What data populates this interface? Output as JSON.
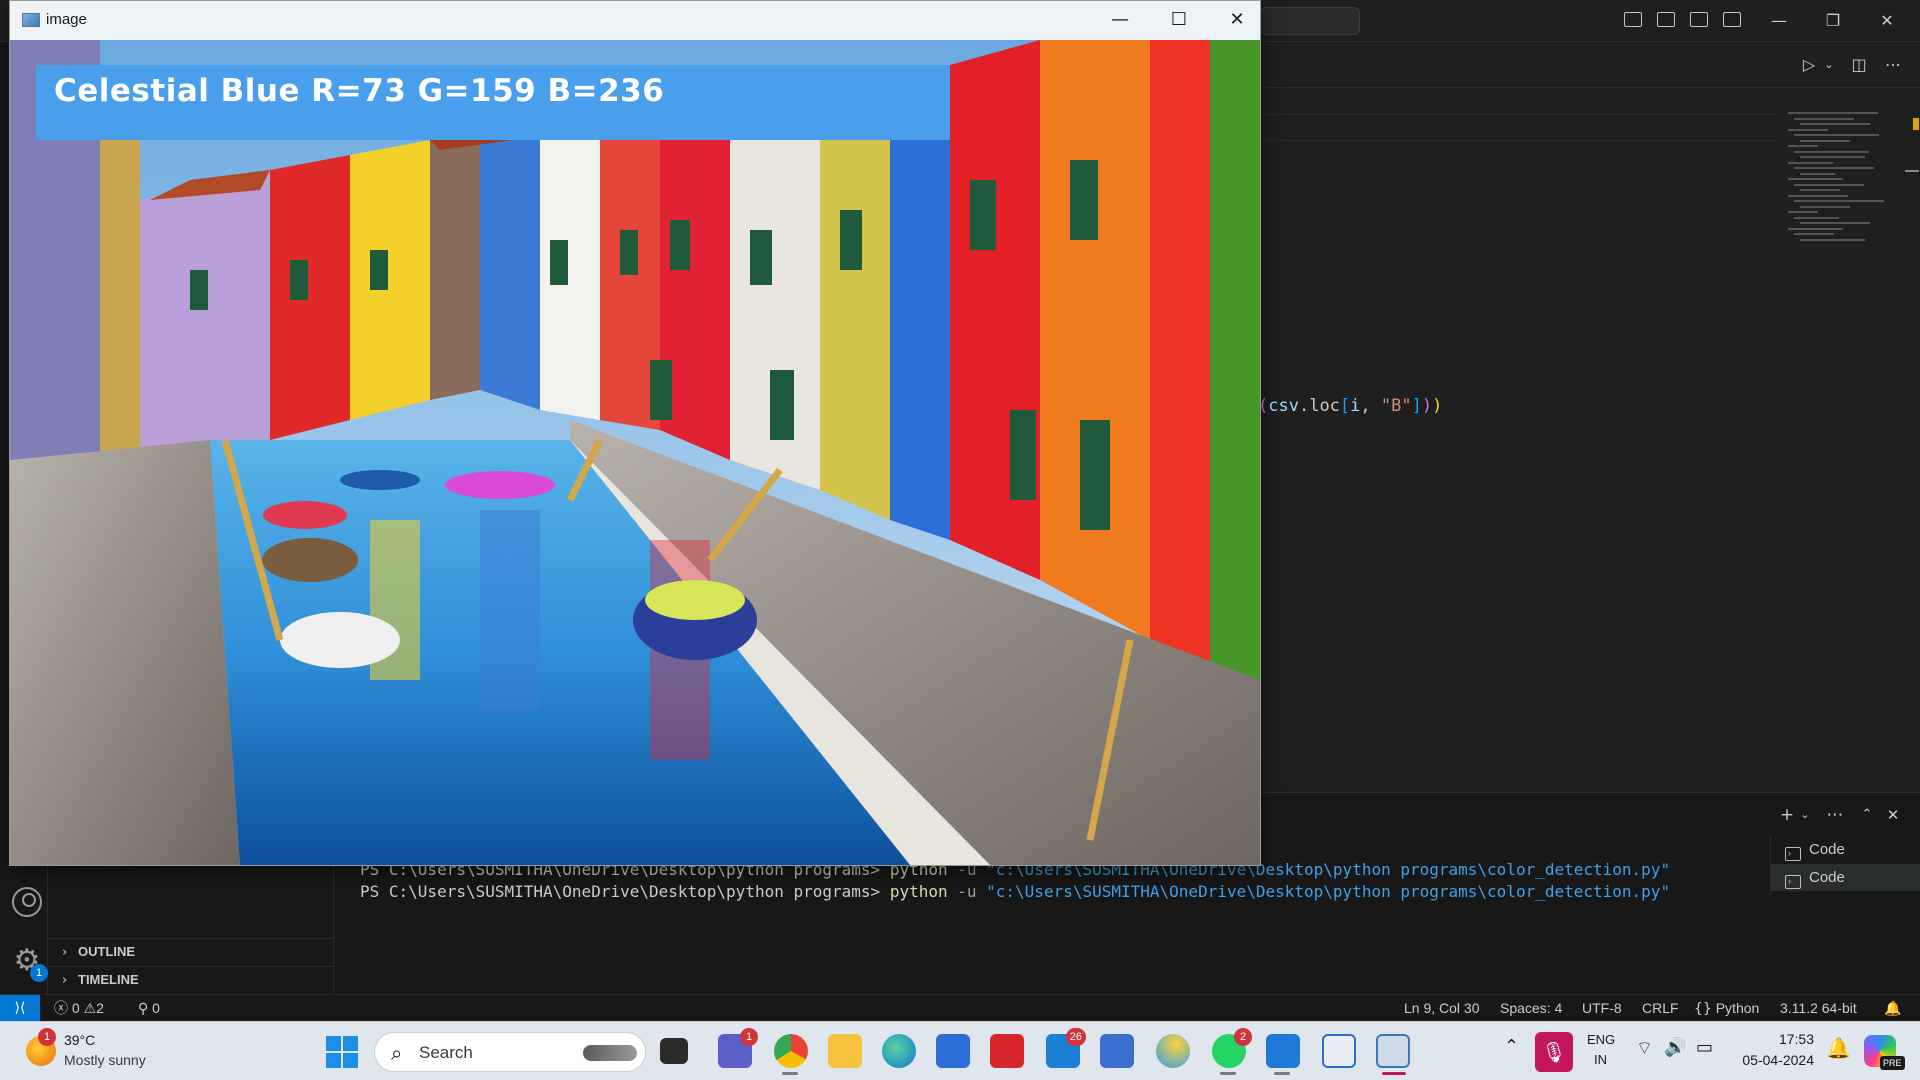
{
  "image_window": {
    "title": "image",
    "minimize_glyph": "—",
    "maximize_glyph": "☐",
    "close_glyph": "✕",
    "color_readout": "Celestial Blue R=73 G=159 B=236",
    "swatch_color": "#499FEC"
  },
  "vscode": {
    "editor_code": {
      "prefix": "(",
      "obj": "csv",
      "dot_loc": ".loc",
      "bracket_open": "[",
      "index": "i, ",
      "str": "\"B\"",
      "bracket_close": "]",
      "close_paren_inner": ")",
      "close_paren_outer": ")"
    },
    "side_sections": [
      {
        "label": "OUTLINE",
        "chevron": "›"
      },
      {
        "label": "TIMELINE",
        "chevron": "›"
      }
    ],
    "settings_badge": "1",
    "terminal": {
      "lines": [
        {
          "prompt": "PS C:\\Users\\SUSMITHA\\OneDrive\\Desktop\\python programs> ",
          "cmd": "python",
          "flag": " -u ",
          "path": "\"c:\\Users\\SUSMITHA\\OneDrive\\Desktop\\python programs\\color_detection.py\""
        },
        {
          "prompt": "PS C:\\Users\\SUSMITHA\\OneDrive\\Desktop\\python programs> ",
          "cmd": "python",
          "flag": " -u ",
          "path": "\"c:\\Users\\SUSMITHA\\OneDrive\\Desktop\\python programs\\color_detection.py\""
        }
      ],
      "sessions": [
        "Code",
        "Code"
      ]
    },
    "statusbar": {
      "remote_glyph": "⟩⟨",
      "errors": "0",
      "warnings": "2",
      "ports": "0",
      "cursor": "Ln 9, Col 30",
      "spaces": "Spaces: 4",
      "encoding": "UTF-8",
      "eol": "CRLF",
      "language": "Python",
      "interpreter": "3.11.2 64-bit"
    }
  },
  "taskbar": {
    "weather_badge": "1",
    "weather_temp": "39°C",
    "weather_desc": "Mostly sunny",
    "search_placeholder": "Search",
    "teams_badge": "1",
    "mail_badge": "26",
    "whatsapp_badge": "2",
    "lang_top": "ENG",
    "lang_bottom": "IN",
    "time": "17:53",
    "date": "05-04-2024",
    "copilot_tag": "PRE"
  }
}
